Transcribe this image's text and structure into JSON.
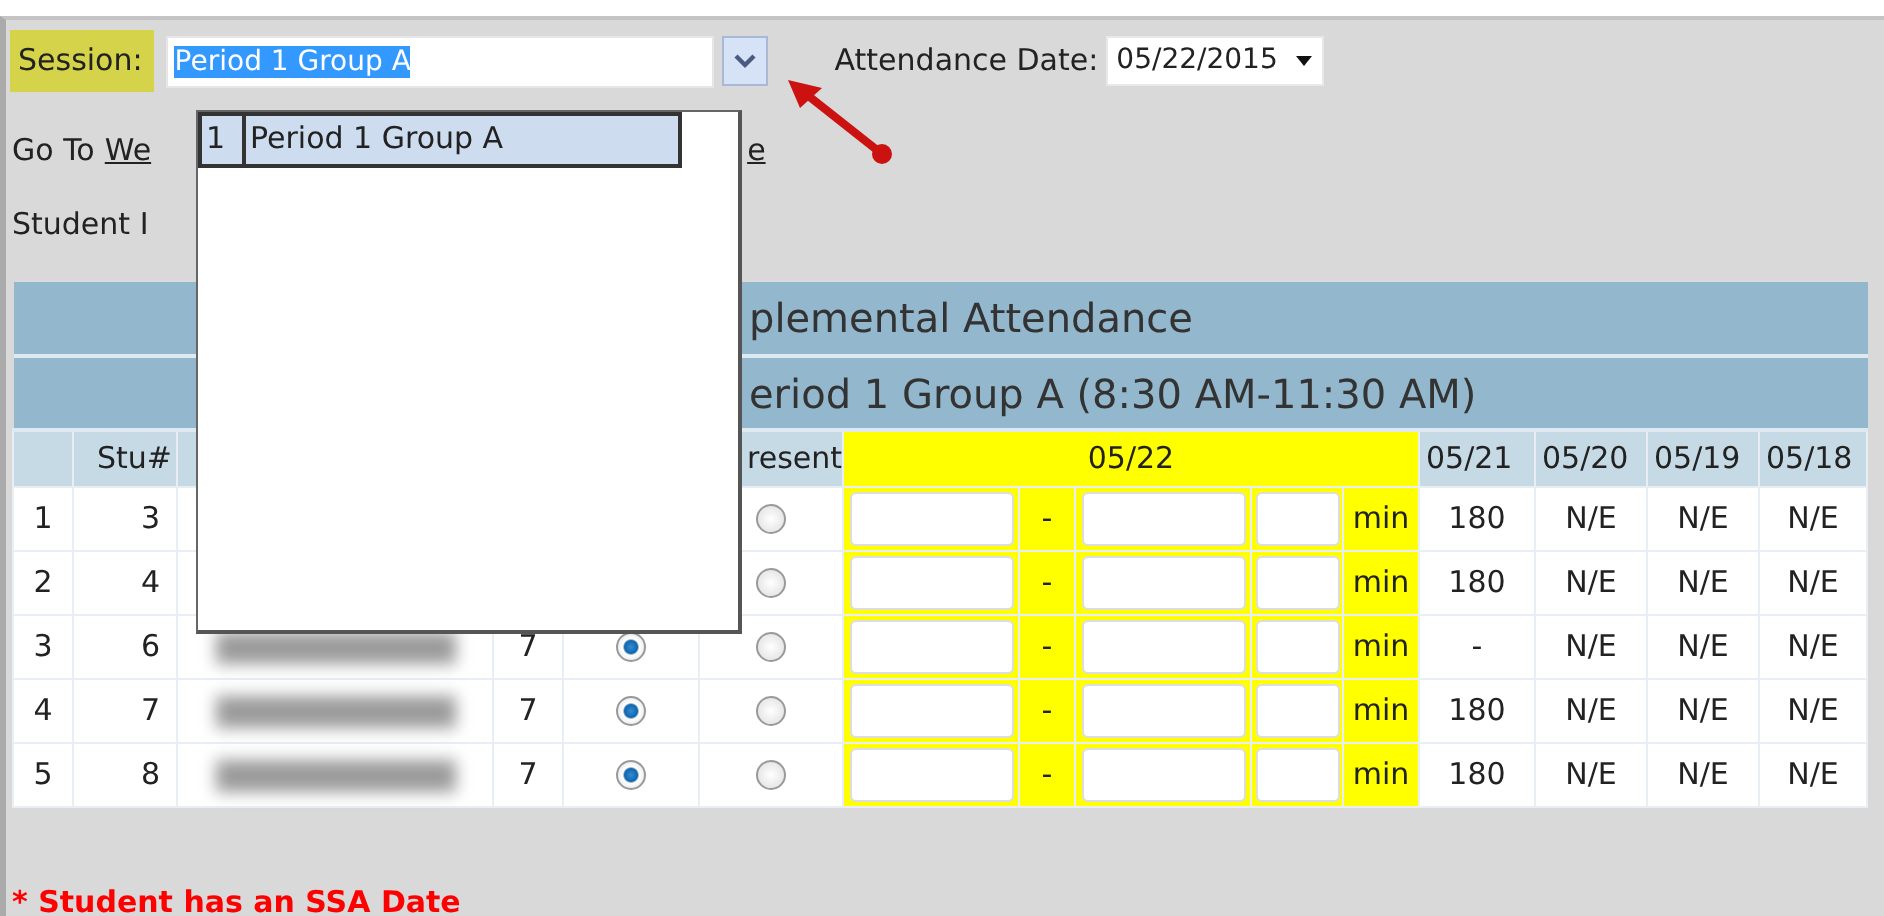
{
  "session": {
    "label": "Session:",
    "value": "Period 1 Group A"
  },
  "date": {
    "label": "Attendance Date:",
    "value": "05/22/2015"
  },
  "dropdown": {
    "items": [
      {
        "index": "1",
        "label": "Period 1 Group A",
        "selected": true
      }
    ]
  },
  "annotation": {
    "kind": "arrow"
  },
  "goto": {
    "text": "Go To",
    "link_start": "We",
    "link_end": "e"
  },
  "student_label": "Student I",
  "table": {
    "title": "plemental Attendance",
    "subtitle": "eriod 1 Group A (8:30 AM-11:30 AM)",
    "columns": [
      "Stu#",
      "resent",
      "05/22",
      "05/21",
      "05/20",
      "05/19",
      "05/18"
    ],
    "rows": [
      {
        "num": "1",
        "stu": "3",
        "present": {
          "selected": false
        },
        "separator": "-",
        "unit": "min",
        "history": [
          "180",
          "N/E",
          "N/E",
          "N/E"
        ]
      },
      {
        "num": "2",
        "stu": "4",
        "present": {
          "selected": false
        },
        "separator": "-",
        "unit": "min",
        "history": [
          "180",
          "N/E",
          "N/E",
          "N/E"
        ]
      },
      {
        "num": "3",
        "stu": "6",
        "name_redacted": true,
        "grade": "7",
        "absent": {
          "selected": true
        },
        "present": {
          "selected": false
        },
        "separator": "-",
        "unit": "min",
        "history": [
          "-",
          "N/E",
          "N/E",
          "N/E"
        ]
      },
      {
        "num": "4",
        "stu": "7",
        "name_redacted": true,
        "grade": "7",
        "absent": {
          "selected": true
        },
        "present": {
          "selected": false
        },
        "separator": "-",
        "unit": "min",
        "history": [
          "180",
          "N/E",
          "N/E",
          "N/E"
        ]
      },
      {
        "num": "5",
        "stu": "8",
        "name_redacted": true,
        "grade": "7",
        "absent": {
          "selected": true
        },
        "present": {
          "selected": false
        },
        "separator": "-",
        "unit": "min",
        "history": [
          "180",
          "N/E",
          "N/E",
          "N/E"
        ]
      }
    ]
  },
  "footnote": "* Student has an SSA Date"
}
